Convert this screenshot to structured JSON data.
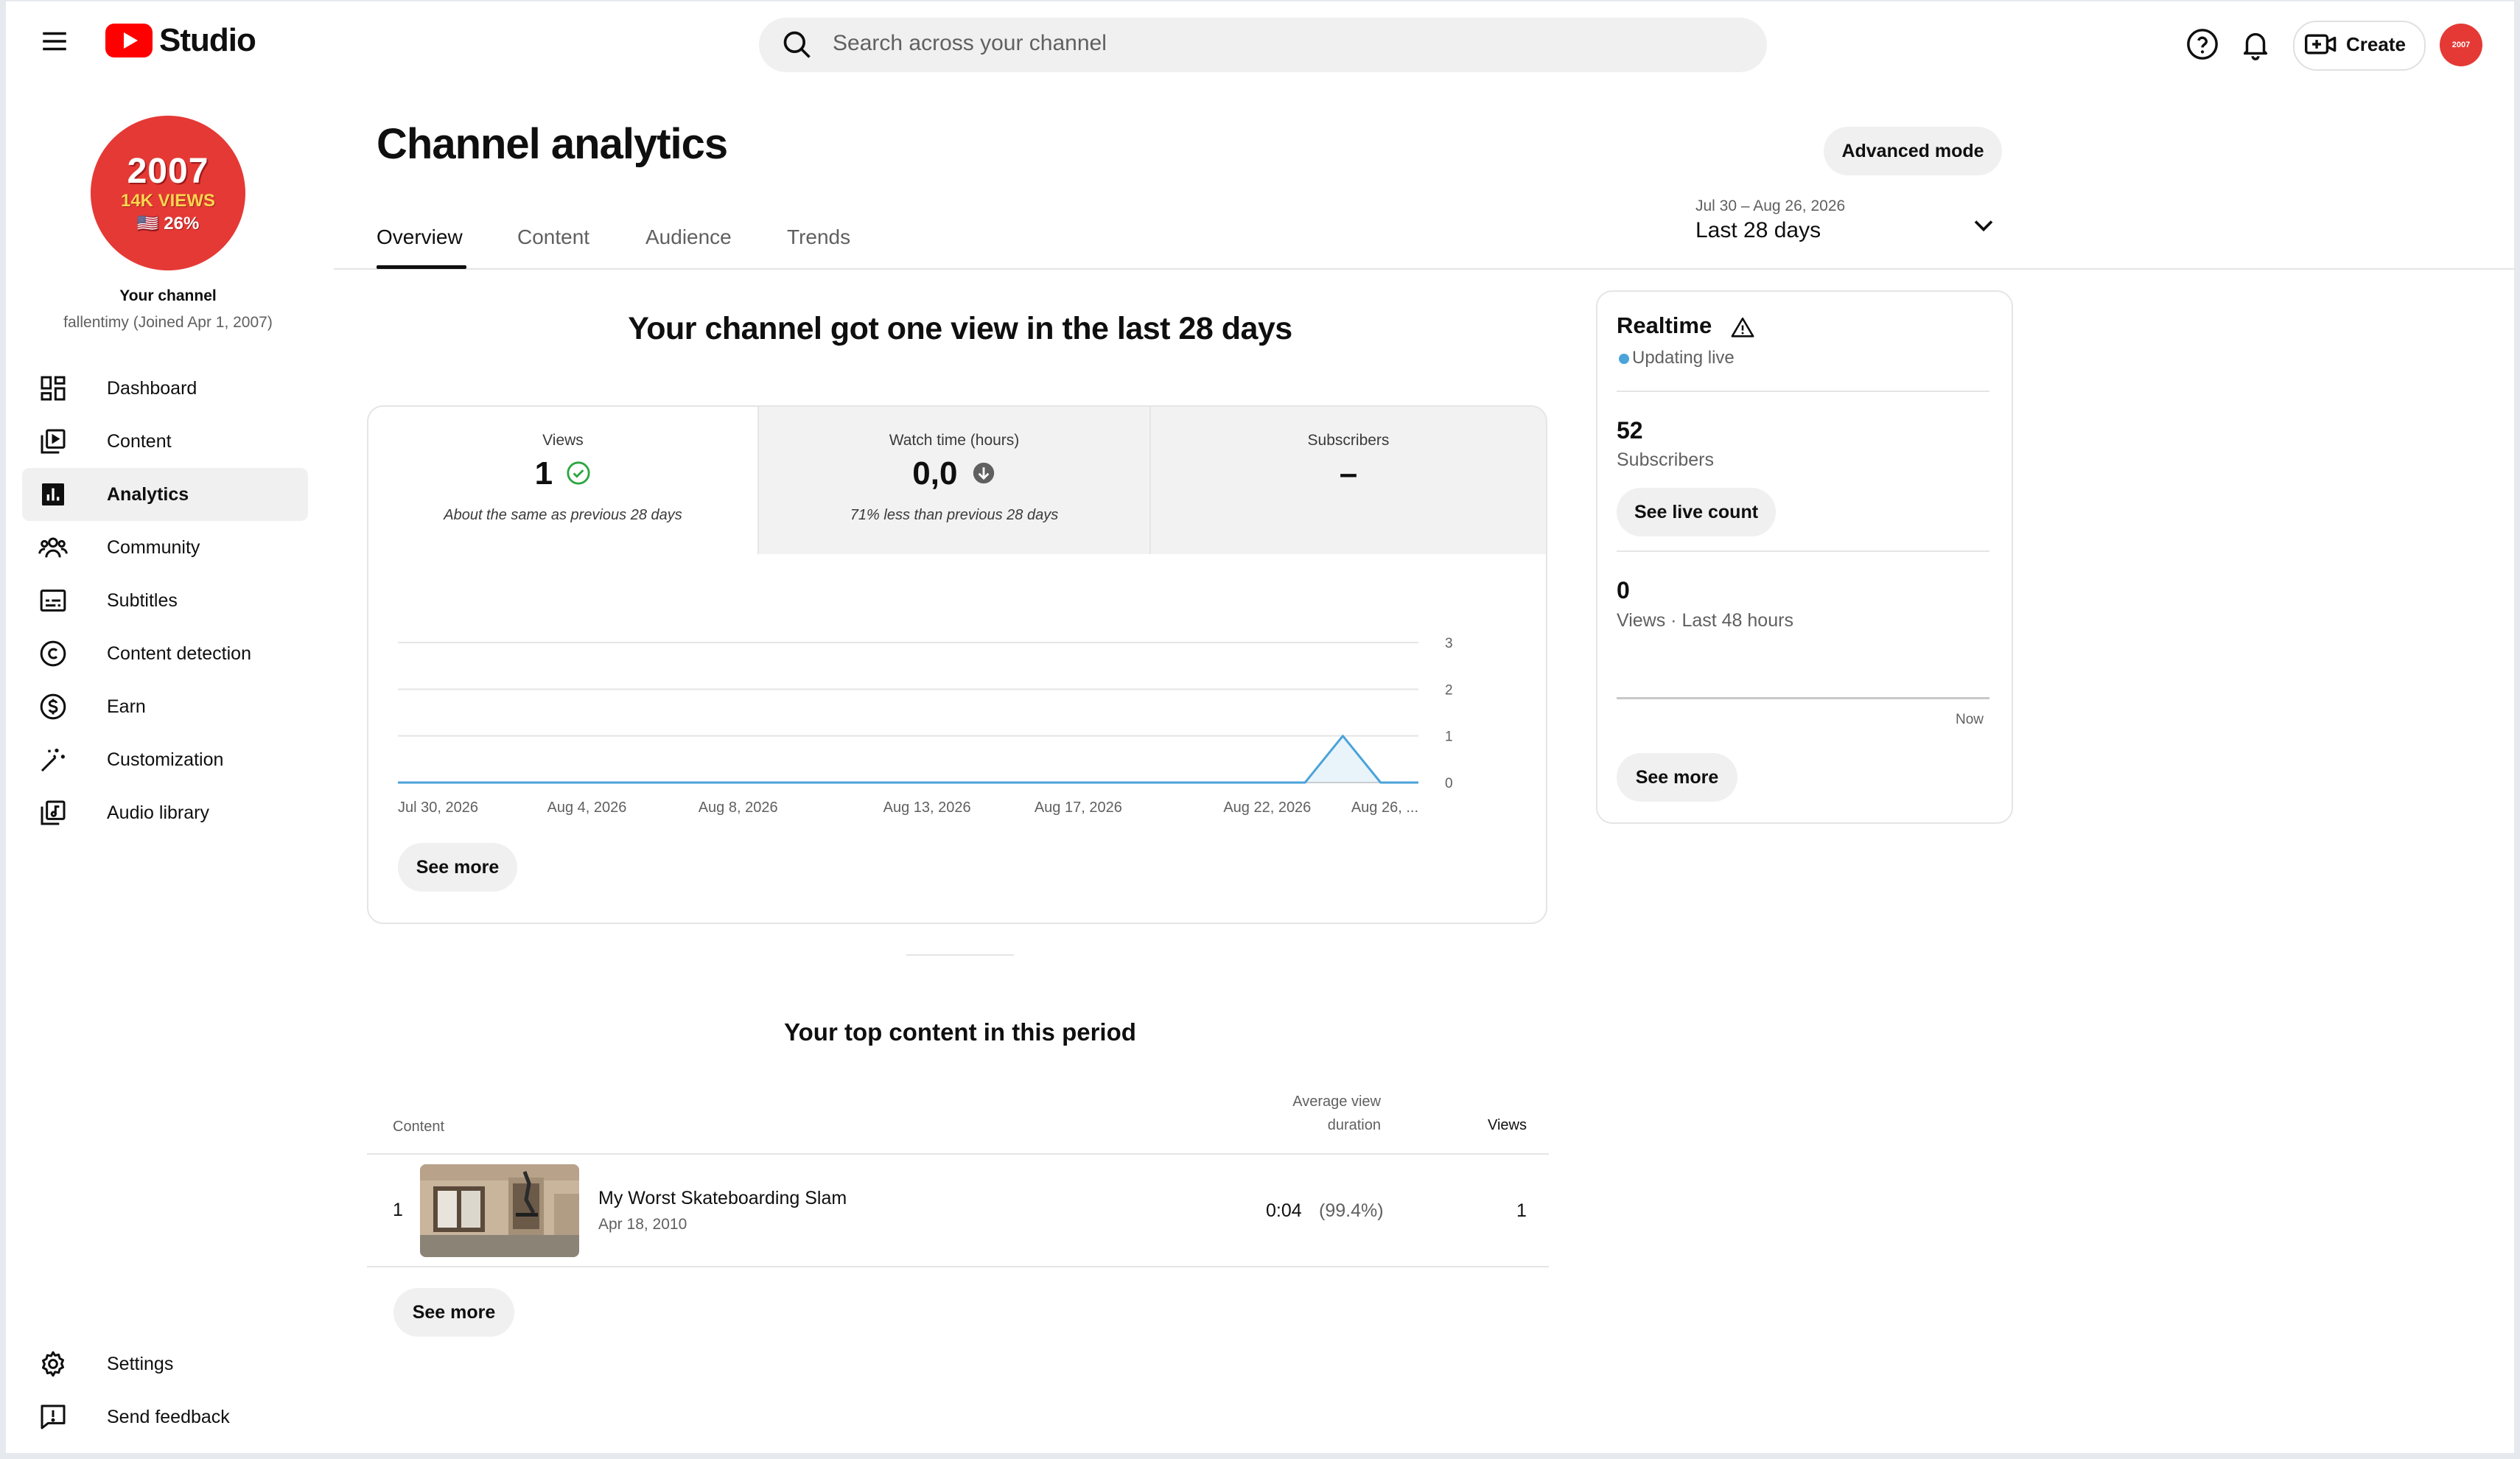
{
  "header": {
    "brand": "Studio",
    "search_placeholder": "Search across your channel",
    "create_label": "Create",
    "avatar_text": "2007"
  },
  "sidebar": {
    "avatar": {
      "line1": "2007",
      "line2": "14K VIEWS",
      "line3": "🇺🇸 26%"
    },
    "channel_title": "Your channel",
    "channel_sub": "fallentimy (Joined Apr 1, 2007)",
    "items": [
      {
        "label": "Dashboard",
        "icon": "dashboard-icon"
      },
      {
        "label": "Content",
        "icon": "content-icon"
      },
      {
        "label": "Analytics",
        "icon": "analytics-icon",
        "active": true
      },
      {
        "label": "Community",
        "icon": "community-icon"
      },
      {
        "label": "Subtitles",
        "icon": "subtitles-icon"
      },
      {
        "label": "Content detection",
        "icon": "copyright-icon"
      },
      {
        "label": "Earn",
        "icon": "dollar-icon"
      },
      {
        "label": "Customization",
        "icon": "magic-wand-icon"
      },
      {
        "label": "Audio library",
        "icon": "audio-library-icon"
      }
    ],
    "bottom_items": [
      {
        "label": "Settings",
        "icon": "gear-icon"
      },
      {
        "label": "Send feedback",
        "icon": "feedback-icon"
      }
    ]
  },
  "page": {
    "title": "Channel analytics",
    "advanced_label": "Advanced mode",
    "tabs": [
      "Overview",
      "Content",
      "Audience",
      "Trends"
    ],
    "active_tab": "Overview",
    "date_range": "Jul 30 – Aug 26, 2026",
    "date_label": "Last 28 days"
  },
  "overview": {
    "headline": "Your channel got one view in the last 28 days",
    "metrics": [
      {
        "label": "Views",
        "value": "1",
        "note": "About the same as previous 28 days",
        "status": "check"
      },
      {
        "label": "Watch time (hours)",
        "value": "0,0",
        "note": "71% less than previous 28 days",
        "status": "down"
      },
      {
        "label": "Subscribers",
        "value": "–",
        "note": "",
        "status": "none"
      }
    ],
    "see_more": "See more"
  },
  "chart_data": {
    "type": "area",
    "x": [
      "Jul 30",
      "Jul 31",
      "Aug 1",
      "Aug 2",
      "Aug 3",
      "Aug 4",
      "Aug 5",
      "Aug 6",
      "Aug 7",
      "Aug 8",
      "Aug 9",
      "Aug 10",
      "Aug 11",
      "Aug 12",
      "Aug 13",
      "Aug 14",
      "Aug 15",
      "Aug 16",
      "Aug 17",
      "Aug 18",
      "Aug 19",
      "Aug 20",
      "Aug 21",
      "Aug 22",
      "Aug 23",
      "Aug 24",
      "Aug 25",
      "Aug 26"
    ],
    "series": [
      {
        "values": [
          0,
          0,
          0,
          0,
          0,
          0,
          0,
          0,
          0,
          0,
          0,
          0,
          0,
          0,
          0,
          0,
          0,
          0,
          0,
          0,
          0,
          0,
          0,
          0,
          0,
          1,
          0,
          0
        ]
      }
    ],
    "x_tick_labels": [
      "Jul 30, 2026",
      "Aug 4, 2026",
      "Aug 8, 2026",
      "Aug 13, 2026",
      "Aug 17, 2026",
      "Aug 22, 2026",
      "Aug 26, ..."
    ],
    "x_tick_index": [
      0,
      5,
      9,
      14,
      18,
      23,
      27
    ],
    "y_ticks": [
      0,
      1,
      2,
      3
    ],
    "ylim": [
      0,
      3
    ],
    "color": "#4ba3d9",
    "grid": true
  },
  "top_content": {
    "title": "Your top content in this period",
    "col_content": "Content",
    "col_avd_line1": "Average view",
    "col_avd_line2": "duration",
    "col_views": "Views",
    "rows": [
      {
        "rank": "1",
        "title": "My Worst Skateboarding Slam",
        "date": "Apr 18, 2010",
        "avd": "0:04",
        "avd_pct": "(99.4%)",
        "views": "1"
      }
    ],
    "see_more": "See more"
  },
  "realtime": {
    "title": "Realtime",
    "live": "Updating live",
    "subs_count": "52",
    "subs_label": "Subscribers",
    "live_count_btn": "See live count",
    "views_count": "0",
    "views_label": "Views · Last 48 hours",
    "now_label": "Now",
    "see_more": "See more"
  },
  "colors": {
    "brand_red": "#ff0000",
    "accent_blue": "#4ba3d9",
    "success_green": "#2ba640"
  }
}
